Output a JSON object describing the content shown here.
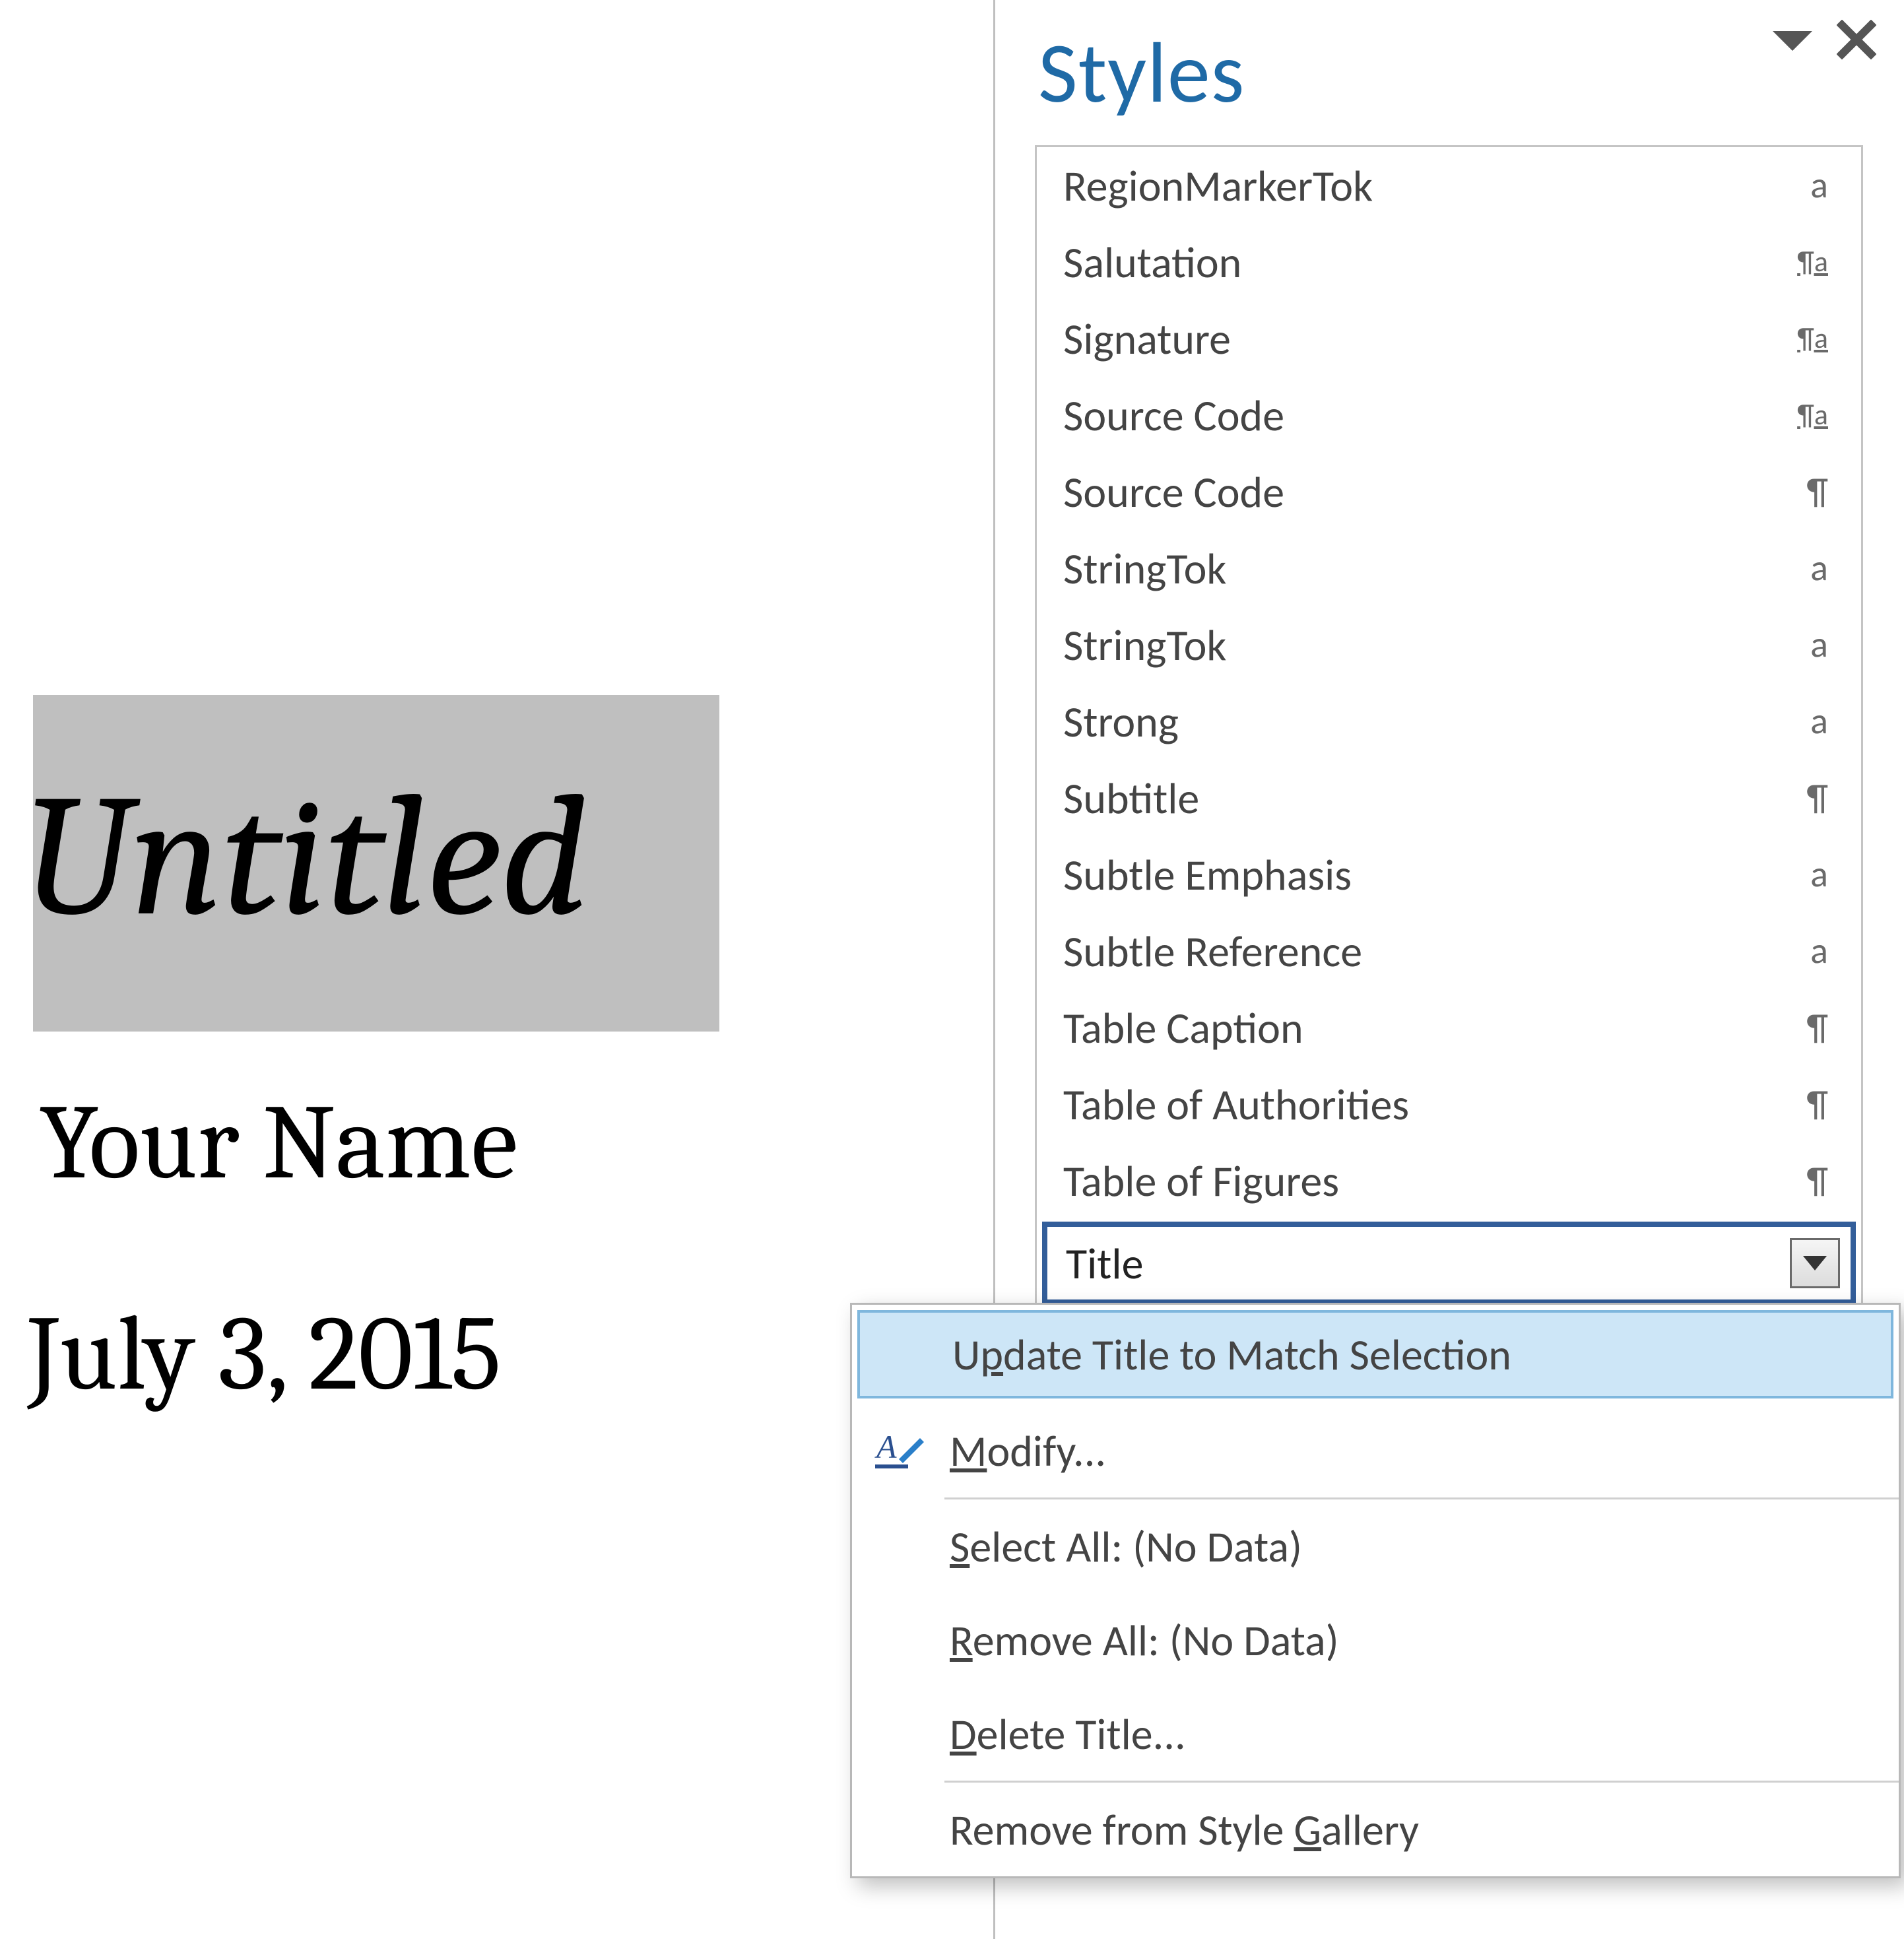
{
  "document": {
    "title_text": "Untitled",
    "author_text": "Your Name",
    "date_text": "July 3, 2015"
  },
  "styles_pane": {
    "title": "Styles",
    "items": [
      {
        "name": "RegionMarkerTok",
        "indicator": "a"
      },
      {
        "name": "Salutation",
        "indicator": "linked"
      },
      {
        "name": "Signature",
        "indicator": "linked"
      },
      {
        "name": "Source Code",
        "indicator": "linked"
      },
      {
        "name": "Source Code",
        "indicator": "pilcrow"
      },
      {
        "name": "StringTok",
        "indicator": "a"
      },
      {
        "name": "StringTok",
        "indicator": "a"
      },
      {
        "name": "Strong",
        "indicator": "a"
      },
      {
        "name": "Subtitle",
        "indicator": "pilcrow"
      },
      {
        "name": "Subtle Emphasis",
        "indicator": "a"
      },
      {
        "name": "Subtle Reference",
        "indicator": "a"
      },
      {
        "name": "Table Caption",
        "indicator": "pilcrow"
      },
      {
        "name": "Table of Authorities",
        "indicator": "pilcrow"
      },
      {
        "name": "Table of Figures",
        "indicator": "pilcrow"
      }
    ],
    "selected": {
      "name": "Title"
    }
  },
  "context_menu": {
    "items": [
      {
        "label_pre": "U",
        "accel": "p",
        "label_post": "date Title to Match Selection",
        "highlight": true,
        "icon": "none"
      },
      {
        "label_pre": "",
        "accel": "M",
        "label_post": "odify...",
        "icon": "modify"
      },
      {
        "sep": true
      },
      {
        "label_pre": "",
        "accel": "S",
        "label_post": "elect All: (No Data)",
        "icon": "none"
      },
      {
        "label_pre": "",
        "accel": "R",
        "label_post": "emove All: (No Data)",
        "icon": "none"
      },
      {
        "label_pre": "",
        "accel": "D",
        "label_post": "elete Title...",
        "icon": "none"
      },
      {
        "sep": true
      },
      {
        "label_pre": "Remove from Style ",
        "accel": "G",
        "label_post": "allery",
        "icon": "none"
      }
    ]
  }
}
